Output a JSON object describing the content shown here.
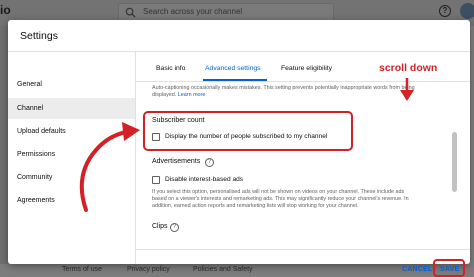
{
  "topbar": {
    "logo_text": "io",
    "search_placeholder": "Search across your channel",
    "help_icon": "?"
  },
  "dialog": {
    "title": "Settings",
    "sidebar": {
      "items": [
        {
          "label": "General",
          "active": false
        },
        {
          "label": "Channel",
          "active": true
        },
        {
          "label": "Upload defaults",
          "active": false
        },
        {
          "label": "Permissions",
          "active": false
        },
        {
          "label": "Community",
          "active": false
        },
        {
          "label": "Agreements",
          "active": false
        }
      ]
    },
    "tabs": [
      {
        "label": "Basic info",
        "active": false
      },
      {
        "label": "Advanced settings",
        "active": true
      },
      {
        "label": "Feature eligibility",
        "active": false
      }
    ],
    "captions_note_line1": "Auto-captioning occasionally makes mistakes. This setting prevents potentially inappropriate words from being",
    "captions_note_line2": "displayed.",
    "learn_more": "Learn more",
    "subscriber_count": {
      "title": "Subscriber count",
      "checkbox_label": "Display the number of people subscribed to my channel",
      "checked": false
    },
    "advertisements": {
      "title": "Advertisements",
      "checkbox_label": "Disable interest-based ads",
      "checked": false,
      "description_line1": "If you select this option, personalised ads will not be shown on videos on your channel. These include ads",
      "description_line2": "based on a viewer's interests and remarketing ads. This may significantly reduce your channel's revenue. In",
      "description_line3": "addition, earned action reports and remarketing lists will stop working for your channel."
    },
    "clips_title": "Clips",
    "buttons": {
      "cancel": "CANCEL",
      "save": "SAVE"
    }
  },
  "annotations": {
    "scroll_label": "scroll down",
    "color": "#d42027"
  },
  "footer_links": [
    "Terms of use",
    "Privacy policy",
    "Policies and Safety"
  ],
  "colors": {
    "accent": "#065fd4",
    "annotation_red": "#d42027"
  }
}
